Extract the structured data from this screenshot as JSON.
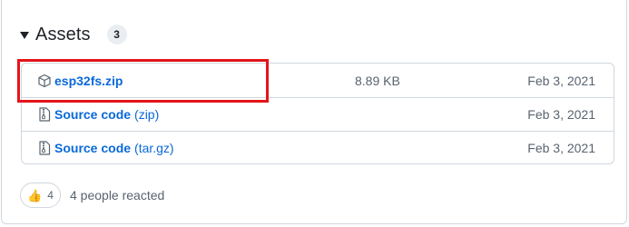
{
  "assets": {
    "title": "Assets",
    "count": "3",
    "items": [
      {
        "icon": "package-icon",
        "name": "esp32fs.zip",
        "suffix": "",
        "size": "8.89 KB",
        "date": "Feb 3, 2021"
      },
      {
        "icon": "file-zip-icon",
        "name": "Source code",
        "suffix": "(zip)",
        "size": "",
        "date": "Feb 3, 2021"
      },
      {
        "icon": "file-zip-icon",
        "name": "Source code",
        "suffix": "(tar.gz)",
        "size": "",
        "date": "Feb 3, 2021"
      }
    ]
  },
  "reactions": {
    "emoji_icon": "thumbs-up-icon",
    "count": "4",
    "summary": "4 people reacted"
  },
  "colors": {
    "link": "#0969da",
    "muted": "#59636e",
    "border": "#d0d7de",
    "highlight": "#e3151a"
  }
}
